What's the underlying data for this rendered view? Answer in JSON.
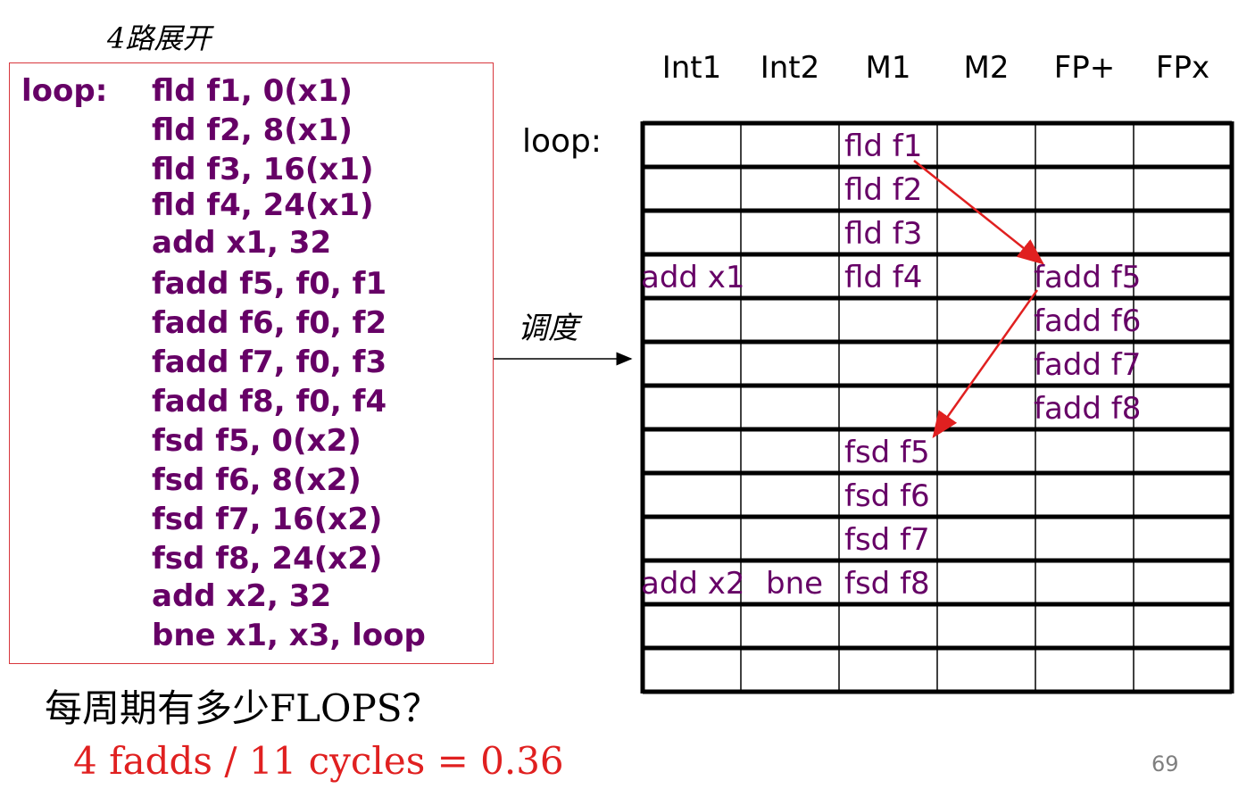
{
  "unroll_title": "4路展开",
  "code": {
    "label": "loop:",
    "lines": [
      "fld f1, 0(x1)",
      "fld f2, 8(x1)",
      "fld f3, 16(x1)",
      "fld f4, 24(x1)",
      "add x1, 32",
      "fadd f5, f0, f1",
      "fadd f6, f0, f2",
      "fadd f7, f0, f3",
      "fadd f8, f0, f4",
      "fsd f5, 0(x2)",
      "fsd f6, 8(x2)",
      "fsd f7, 16(x2)",
      "fsd f8, 24(x2)",
      "add x2, 32",
      "bne x1, x3, loop"
    ]
  },
  "schedule_label": "调度",
  "table": {
    "loop_label": "loop:",
    "columns": [
      "Int1",
      "Int2",
      "M1",
      "M2",
      "FP+",
      "FPx"
    ],
    "row_count": 13,
    "cells": [
      {
        "row": 0,
        "col": 2,
        "text": "fld f1"
      },
      {
        "row": 1,
        "col": 2,
        "text": "fld f2"
      },
      {
        "row": 2,
        "col": 2,
        "text": "fld f3"
      },
      {
        "row": 3,
        "col": 0,
        "text": "add x1"
      },
      {
        "row": 3,
        "col": 2,
        "text": "fld f4"
      },
      {
        "row": 3,
        "col": 4,
        "text": "fadd f5"
      },
      {
        "row": 4,
        "col": 4,
        "text": "fadd f6"
      },
      {
        "row": 5,
        "col": 4,
        "text": "fadd f7"
      },
      {
        "row": 6,
        "col": 4,
        "text": "fadd f8"
      },
      {
        "row": 7,
        "col": 2,
        "text": "fsd f5"
      },
      {
        "row": 8,
        "col": 2,
        "text": "fsd f6"
      },
      {
        "row": 9,
        "col": 2,
        "text": "fsd f7"
      },
      {
        "row": 10,
        "col": 0,
        "text": "add x2"
      },
      {
        "row": 10,
        "col": 1,
        "text": "bne"
      },
      {
        "row": 10,
        "col": 2,
        "text": "fsd f8"
      }
    ],
    "dependencies": [
      {
        "from": "fld f1",
        "to": "fadd f5"
      },
      {
        "from": "fadd f5",
        "to": "fsd f5"
      }
    ],
    "arrow_color": "#e02020"
  },
  "question": "每周期有多少FLOPS？",
  "answer": "4 fadds / 11 cycles = 0.36",
  "page_number": "69",
  "colors": {
    "code_text": "#660066",
    "box_border": "#d8373d",
    "answer": "#e02020",
    "page_number": "#7f7f7f"
  }
}
